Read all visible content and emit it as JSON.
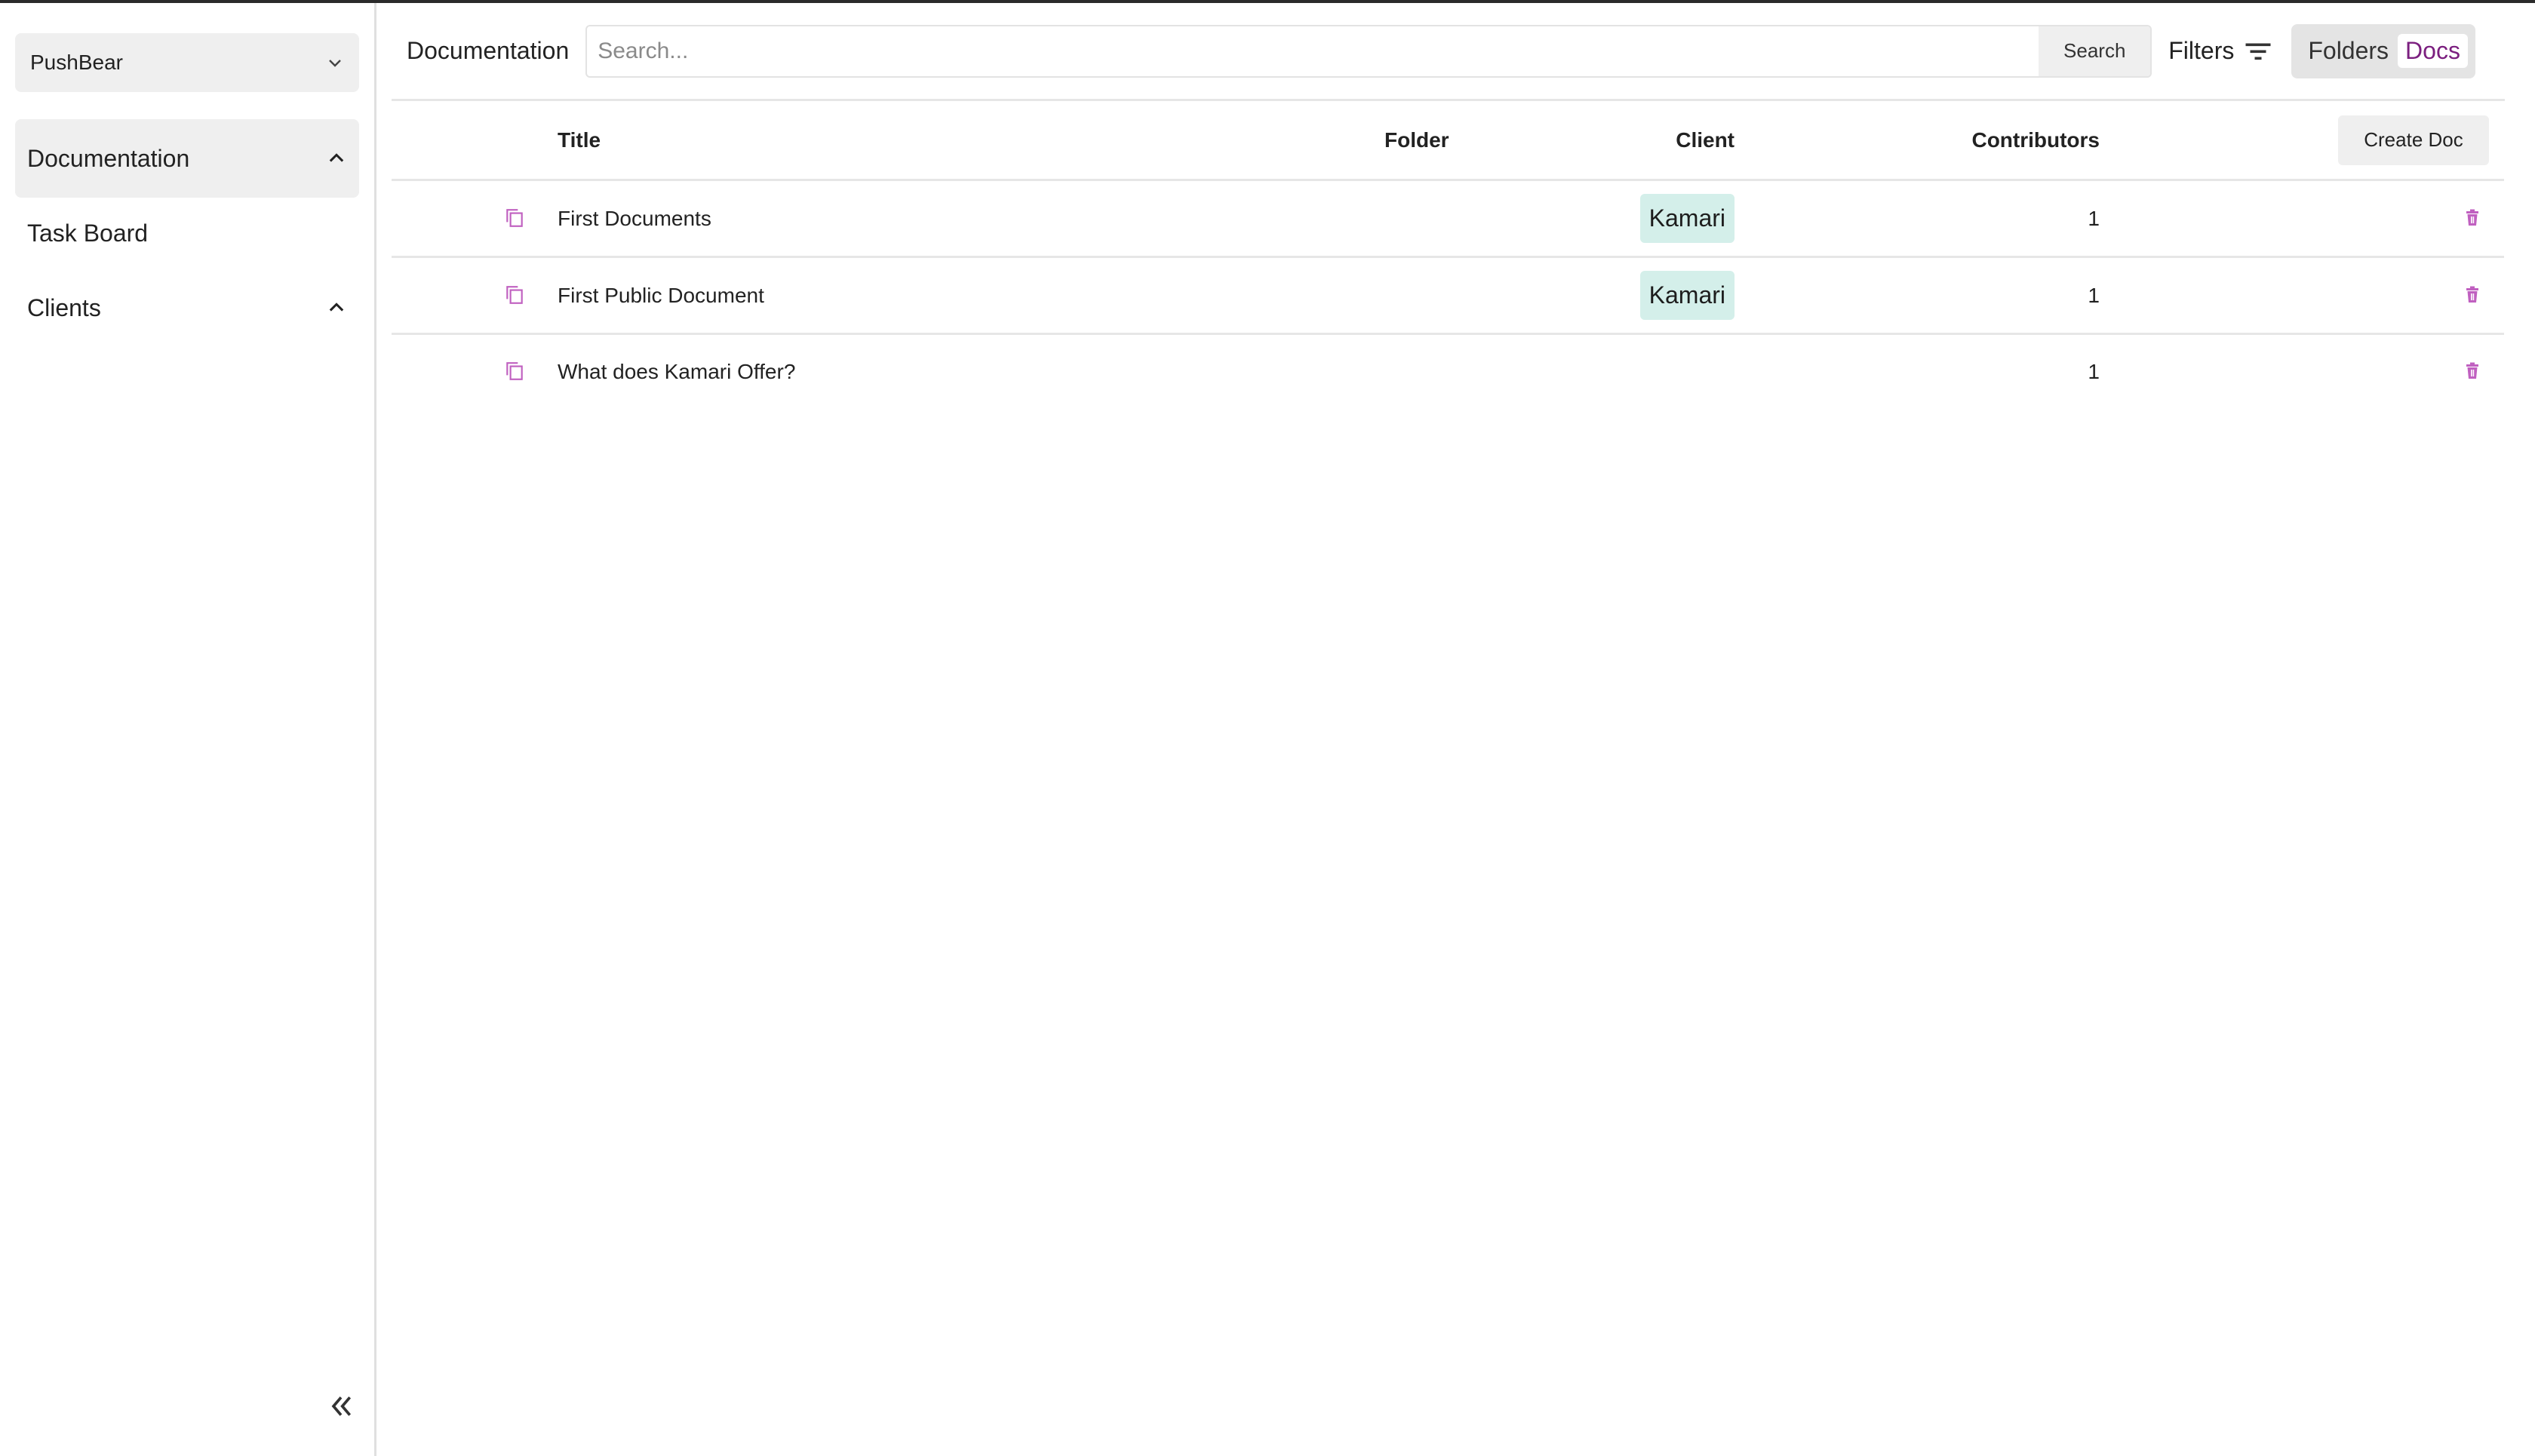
{
  "sidebar": {
    "workspace": "PushBear",
    "items": [
      {
        "label": "Documentation",
        "expanded": true
      },
      {
        "label": "Task Board"
      },
      {
        "label": "Clients",
        "expanded": true
      }
    ]
  },
  "toolbar": {
    "title": "Documentation",
    "search_placeholder": "Search...",
    "search_label": "Search",
    "filters_label": "Filters",
    "toggle_folders": "Folders",
    "toggle_docs": "Docs"
  },
  "table": {
    "headers": {
      "title": "Title",
      "folder": "Folder",
      "client": "Client",
      "contributors": "Contributors"
    },
    "create_label": "Create Doc",
    "rows": [
      {
        "title": "First Documents",
        "folder": "",
        "client": "Kamari",
        "contributors": "1"
      },
      {
        "title": "First Public Document",
        "folder": "",
        "client": "Kamari",
        "contributors": "1"
      },
      {
        "title": "What does Kamari Offer?",
        "folder": "",
        "client": "",
        "contributors": "1"
      }
    ]
  },
  "colors": {
    "accent": "#7b1f7f",
    "icon_pink": "#c060c0",
    "chip_bg": "#d4efea"
  }
}
